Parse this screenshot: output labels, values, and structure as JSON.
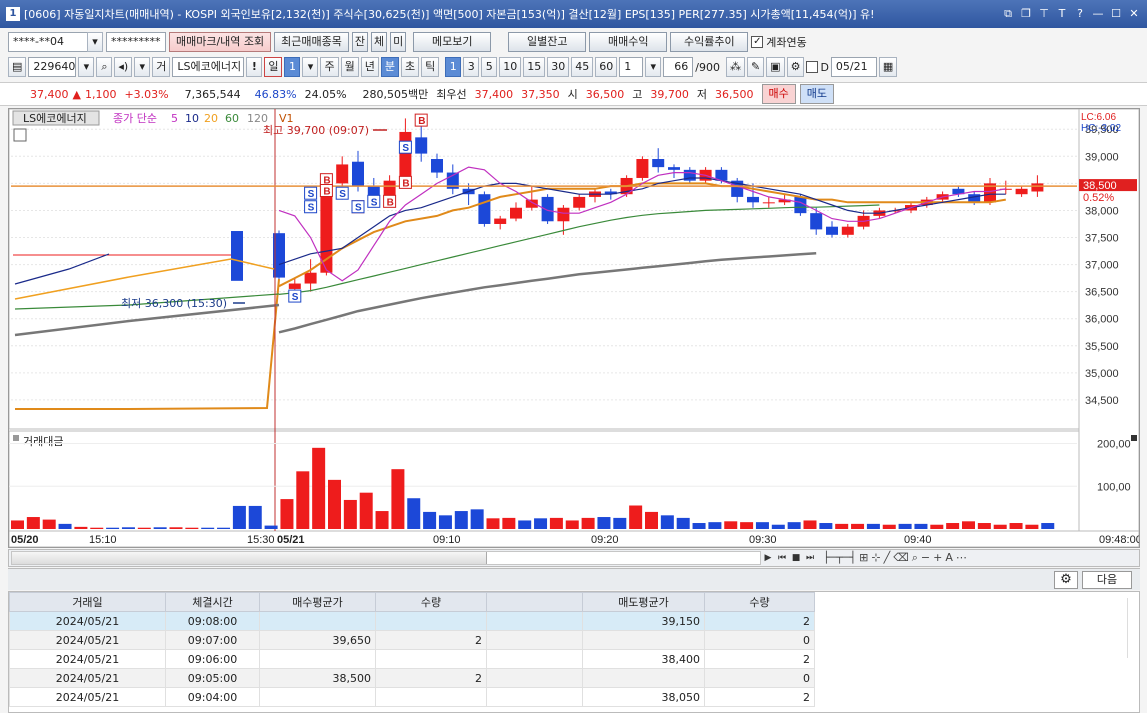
{
  "title": "[0606] 자동일지차트(매매내역) - KOSPI 외국인보유[2,132(천)] 주식수[30,625(천)] 액면[500] 자본금[153(억)] 결산[12월] EPS[135] PER[277.35] 시가총액[11,454(억)] 유!",
  "title_num": "1",
  "account": "****-**04",
  "password": "*********",
  "buttons": {
    "mark": "매매마크/내역 조회",
    "recent": "최근매매종목",
    "jan": "잔",
    "che": "체",
    "mi": "미",
    "memo": "메모보기",
    "daily_balance": "일별잔고",
    "profit": "매매수익",
    "return_trend": "수익률추이",
    "link_account": "계좌연동",
    "buy": "매수",
    "sell": "매도",
    "next": "다음"
  },
  "stock_code": "229640",
  "stock_name": "LS에코에너지",
  "period_tabs": [
    "일",
    "주",
    "월",
    "년",
    "분",
    "초",
    "틱"
  ],
  "minute_tabs": [
    "1",
    "3",
    "5",
    "10",
    "15",
    "30",
    "45",
    "60"
  ],
  "period_value": "1",
  "period_value2": "1",
  "count_value": "66",
  "count_total": "/900",
  "date_chk_label": "D",
  "date_value": "05/21",
  "quote": {
    "price": "37,400",
    "arrow": "▲",
    "change": "1,100",
    "rate": "+3.03%",
    "volume": "7,365,544",
    "pct1": "46.83%",
    "pct2": "24.05%",
    "amount": "280,505백만",
    "best_label": "최우선",
    "ask": "37,400",
    "bid": "37,350",
    "open_label": "시",
    "open": "36,500",
    "high_label": "고",
    "high": "39,700",
    "low_label": "저",
    "low": "36,500"
  },
  "legend": {
    "name": "LS에코에너지",
    "price_label": "종가 단순",
    "ma": [
      "5",
      "10",
      "20",
      "60",
      "120"
    ],
    "v1": "V1",
    "ma_colors": [
      "#c030c0",
      "#1a2a8a",
      "#f0a020",
      "#3a8a3a",
      "#888888"
    ]
  },
  "price_axis": [
    "39,500",
    "39,000",
    "38,500",
    "38,000",
    "37,500",
    "37,000",
    "36,500",
    "36,000",
    "35,500",
    "35,000",
    "34,500"
  ],
  "current_price_tag": "38,500",
  "current_rate_tag": "0.52%",
  "lc_label": "LC:6.06",
  "hc_label": "HC:-3.02",
  "high_annotation": "최고 39,700 (09:07)",
  "low_annotation": "최저 36,300 (15:30)",
  "volume_title": "거래대금",
  "volume_axis": [
    "200,00",
    "100,00"
  ],
  "time_axis": [
    "05/20",
    "15:10",
    "15:30",
    "05/21",
    "09:10",
    "09:20",
    "09:30",
    "09:40",
    "09:48:00"
  ],
  "colors": {
    "up": "#ee1c1c",
    "down": "#1c48d8",
    "accent": "#5b8bd5",
    "title": "#3962aa"
  },
  "trade_marks": {
    "buy": "B",
    "sell": "S"
  },
  "chart_data": {
    "type": "candlestick",
    "candles": [
      {
        "o": 37580,
        "h": 37630,
        "l": 36680,
        "c": 36760
      },
      {
        "o": 36550,
        "h": 36750,
        "l": 36400,
        "c": 36650
      },
      {
        "o": 36650,
        "h": 37100,
        "l": 36500,
        "c": 36850
      },
      {
        "o": 36850,
        "h": 38450,
        "l": 36800,
        "c": 38450
      },
      {
        "o": 38500,
        "h": 39000,
        "l": 38200,
        "c": 38850
      },
      {
        "o": 38900,
        "h": 39100,
        "l": 38350,
        "c": 38450
      },
      {
        "o": 38450,
        "h": 38600,
        "l": 38100,
        "c": 38250
      },
      {
        "o": 38250,
        "h": 38650,
        "l": 38100,
        "c": 38550
      },
      {
        "o": 38550,
        "h": 39700,
        "l": 38500,
        "c": 39450
      },
      {
        "o": 39350,
        "h": 39600,
        "l": 38900,
        "c": 39050
      },
      {
        "o": 38950,
        "h": 39050,
        "l": 38600,
        "c": 38700
      },
      {
        "o": 38700,
        "h": 38850,
        "l": 38300,
        "c": 38400
      },
      {
        "o": 38400,
        "h": 38500,
        "l": 38100,
        "c": 38300
      },
      {
        "o": 38300,
        "h": 38350,
        "l": 37700,
        "c": 37750
      },
      {
        "o": 37750,
        "h": 37900,
        "l": 37650,
        "c": 37850
      },
      {
        "o": 37850,
        "h": 38150,
        "l": 37800,
        "c": 38050
      },
      {
        "o": 38050,
        "h": 38450,
        "l": 38000,
        "c": 38200
      },
      {
        "o": 38250,
        "h": 38300,
        "l": 37750,
        "c": 37800
      },
      {
        "o": 37800,
        "h": 38100,
        "l": 37550,
        "c": 38050
      },
      {
        "o": 38050,
        "h": 38300,
        "l": 38000,
        "c": 38250
      },
      {
        "o": 38250,
        "h": 38400,
        "l": 38150,
        "c": 38350
      },
      {
        "o": 38350,
        "h": 38400,
        "l": 38200,
        "c": 38300
      },
      {
        "o": 38300,
        "h": 38650,
        "l": 38250,
        "c": 38600
      },
      {
        "o": 38600,
        "h": 39000,
        "l": 38550,
        "c": 38950
      },
      {
        "o": 38950,
        "h": 39150,
        "l": 38700,
        "c": 38800
      },
      {
        "o": 38800,
        "h": 38850,
        "l": 38600,
        "c": 38750
      },
      {
        "o": 38750,
        "h": 38800,
        "l": 38500,
        "c": 38550
      },
      {
        "o": 38550,
        "h": 38800,
        "l": 38500,
        "c": 38750
      },
      {
        "o": 38750,
        "h": 38800,
        "l": 38500,
        "c": 38550
      },
      {
        "o": 38550,
        "h": 38600,
        "l": 38150,
        "c": 38250
      },
      {
        "o": 38250,
        "h": 38500,
        "l": 38050,
        "c": 38150
      },
      {
        "o": 38150,
        "h": 38250,
        "l": 38050,
        "c": 38150
      },
      {
        "o": 38150,
        "h": 38300,
        "l": 38100,
        "c": 38200
      },
      {
        "o": 38250,
        "h": 38300,
        "l": 37900,
        "c": 37950
      },
      {
        "o": 37950,
        "h": 38050,
        "l": 37550,
        "c": 37650
      },
      {
        "o": 37700,
        "h": 37800,
        "l": 37500,
        "c": 37550
      },
      {
        "o": 37550,
        "h": 37750,
        "l": 37500,
        "c": 37700
      },
      {
        "o": 37700,
        "h": 38000,
        "l": 37650,
        "c": 37900
      },
      {
        "o": 37900,
        "h": 38050,
        "l": 37850,
        "c": 38000
      },
      {
        "o": 38000,
        "h": 38050,
        "l": 37950,
        "c": 38000
      },
      {
        "o": 38000,
        "h": 38150,
        "l": 37950,
        "c": 38100
      },
      {
        "o": 38100,
        "h": 38250,
        "l": 38050,
        "c": 38200
      },
      {
        "o": 38200,
        "h": 38350,
        "l": 38150,
        "c": 38300
      },
      {
        "o": 38400,
        "h": 38450,
        "l": 38250,
        "c": 38300
      },
      {
        "o": 38300,
        "h": 38350,
        "l": 38100,
        "c": 38150
      },
      {
        "o": 38150,
        "h": 38600,
        "l": 38100,
        "c": 38500
      },
      {
        "o": 38400,
        "h": 38550,
        "l": 38300,
        "c": 38400
      },
      {
        "o": 38300,
        "h": 38450,
        "l": 38250,
        "c": 38400
      },
      {
        "o": 38350,
        "h": 38650,
        "l": 38250,
        "c": 38500
      }
    ],
    "volume": [
      20,
      28,
      22,
      12,
      5,
      3,
      3,
      4,
      3,
      4,
      4,
      3,
      3,
      3,
      54,
      54,
      8,
      70,
      135,
      190,
      115,
      68,
      85,
      42,
      140,
      72,
      40,
      32,
      42,
      46,
      25,
      26,
      20,
      25,
      26,
      20,
      26,
      28,
      26,
      55,
      40,
      32,
      26,
      14,
      16,
      18,
      16,
      16,
      10,
      16,
      20,
      14,
      12,
      12,
      12,
      10,
      12,
      12,
      10,
      14,
      18,
      14,
      10,
      14,
      10,
      14
    ],
    "volume_colors": [
      "u",
      "u",
      "u",
      "d",
      "u",
      "u",
      "d",
      "d",
      "u",
      "d",
      "u",
      "u",
      "d",
      "d",
      "d",
      "d",
      "d",
      "u",
      "u",
      "u",
      "u",
      "u",
      "u",
      "u",
      "u",
      "d",
      "d",
      "d",
      "d",
      "d",
      "u",
      "u",
      "d",
      "d",
      "u",
      "u",
      "u",
      "d",
      "d",
      "u",
      "u",
      "d",
      "d",
      "d",
      "d",
      "u",
      "u",
      "d",
      "d",
      "d",
      "u",
      "d",
      "u",
      "u",
      "d",
      "u",
      "d",
      "d",
      "u",
      "u",
      "u",
      "u",
      "u",
      "u",
      "u",
      "d"
    ],
    "ma5": [
      38000,
      37900,
      37500,
      36900,
      36700,
      36900,
      37350,
      37800,
      38100,
      38300,
      38500,
      38650,
      38800,
      38750,
      38500,
      38350,
      38150,
      38000,
      37950,
      37950,
      38050,
      38150,
      38300,
      38500,
      38650,
      38700,
      38700,
      38650,
      38550,
      38450,
      38350,
      38250,
      38200,
      38150,
      38000,
      37850,
      37800,
      37800,
      37850,
      37950,
      38050,
      38150,
      38250,
      38300,
      38350,
      38350,
      38400
    ],
    "ma10": [
      37000,
      37100,
      37200,
      37250,
      37300,
      37500,
      37700,
      37900,
      38000,
      38050,
      38150,
      38250,
      38350,
      38450,
      38500,
      38500,
      38450,
      38400,
      38350,
      38300,
      38300,
      38300,
      38350,
      38400,
      38500,
      38550,
      38600,
      38600,
      38550,
      38500,
      38450,
      38400,
      38350,
      38300,
      38200,
      38100,
      38000,
      37950,
      37950,
      38000,
      38050,
      38100,
      38150,
      38200,
      38250,
      38300,
      38300
    ],
    "ma20": [
      36600,
      36750,
      36900,
      37100,
      37300,
      37450,
      37600,
      37700,
      37800,
      37850,
      37900,
      38000,
      38050,
      38150,
      38250,
      38300,
      38350,
      38400,
      38400,
      38400,
      38400,
      38450,
      38450,
      38500,
      38500,
      38500,
      38500,
      38500,
      38450,
      38450,
      38400,
      38350,
      38300,
      38250,
      38200,
      38200,
      38150,
      38150,
      38150,
      38150,
      38150,
      38150,
      38150,
      38150,
      38150,
      38150,
      38200
    ],
    "ma60": [
      36450,
      36480,
      36520,
      36580,
      36650,
      36720,
      36790,
      36860,
      36930,
      37000,
      37070,
      37140,
      37210,
      37280,
      37350,
      37420,
      37490,
      37560,
      37630,
      37700,
      37760,
      37820,
      37870,
      37910,
      37940,
      37960,
      37980,
      38000,
      38010,
      38020,
      38030,
      38040,
      38050,
      38060,
      38060,
      38070,
      38080,
      38090,
      38100
    ],
    "ma120": [
      35750,
      35820,
      35900,
      35980,
      36060,
      36140,
      36200,
      36260,
      36320,
      36380,
      36430,
      36480,
      36530,
      36580,
      36620,
      36660,
      36700,
      36740,
      36780,
      36820,
      36850,
      36880,
      36910,
      36940,
      36970,
      37000,
      37030,
      37060,
      37090,
      37110,
      37130,
      37150,
      37170,
      37190,
      37210
    ],
    "y_range": [
      34000,
      39800
    ]
  },
  "table": {
    "headers": [
      "거래일",
      "체결시간",
      "매수평균가",
      "수량",
      "",
      "매도평균가",
      "수량"
    ],
    "rows": [
      [
        "2024/05/21",
        "09:08:00",
        "",
        "",
        "",
        "39,150",
        "2"
      ],
      [
        "2024/05/21",
        "09:07:00",
        "39,650",
        "2",
        "",
        "",
        "0"
      ],
      [
        "2024/05/21",
        "09:06:00",
        "",
        "",
        "",
        "38,400",
        "2"
      ],
      [
        "2024/05/21",
        "09:05:00",
        "38,500",
        "2",
        "",
        "",
        "0"
      ],
      [
        "2024/05/21",
        "09:04:00",
        "",
        "",
        "",
        "38,050",
        "2"
      ]
    ]
  }
}
